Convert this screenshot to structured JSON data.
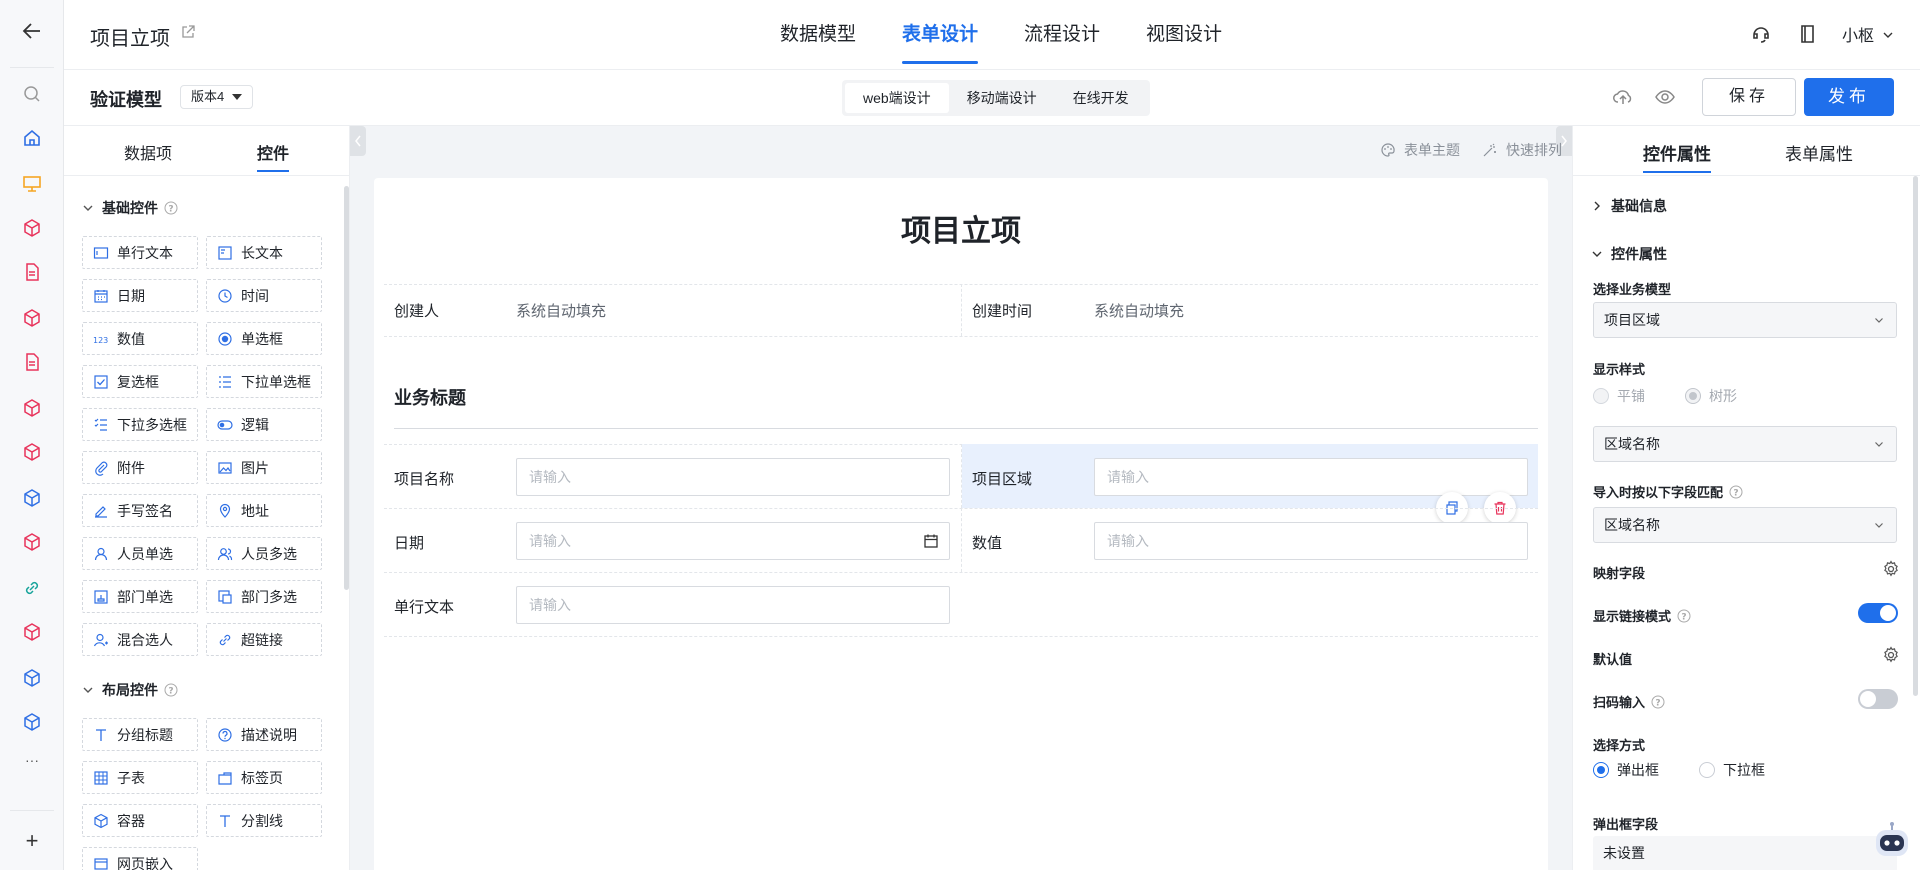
{
  "header": {
    "title": "项目立项",
    "tabs": [
      {
        "label": "数据模型"
      },
      {
        "label": "表单设计"
      },
      {
        "label": "流程设计"
      },
      {
        "label": "视图设计"
      }
    ],
    "user": "小枢"
  },
  "subbar": {
    "model_name": "验证模型",
    "version": "版本4",
    "modes": [
      {
        "label": "web端设计"
      },
      {
        "label": "移动端设计"
      },
      {
        "label": "在线开发"
      }
    ],
    "save_label": "保存",
    "publish_label": "发布"
  },
  "left_panel": {
    "tabs": [
      {
        "label": "数据项"
      },
      {
        "label": "控件"
      }
    ],
    "basic_group": "基础控件",
    "basic_controls": [
      {
        "label": "单行文本"
      },
      {
        "label": "长文本"
      },
      {
        "label": "日期"
      },
      {
        "label": "时间"
      },
      {
        "label": "数值"
      },
      {
        "label": "单选框"
      },
      {
        "label": "复选框"
      },
      {
        "label": "下拉单选框"
      },
      {
        "label": "下拉多选框"
      },
      {
        "label": "逻辑"
      },
      {
        "label": "附件"
      },
      {
        "label": "图片"
      },
      {
        "label": "手写签名"
      },
      {
        "label": "地址"
      },
      {
        "label": "人员单选"
      },
      {
        "label": "人员多选"
      },
      {
        "label": "部门单选"
      },
      {
        "label": "部门多选"
      },
      {
        "label": "混合选人"
      },
      {
        "label": "超链接"
      }
    ],
    "layout_group": "布局控件",
    "layout_controls": [
      {
        "label": "分组标题"
      },
      {
        "label": "描述说明"
      },
      {
        "label": "子表"
      },
      {
        "label": "标签页"
      },
      {
        "label": "容器"
      },
      {
        "label": "分割线"
      },
      {
        "label": "网页嵌入"
      }
    ]
  },
  "canvas": {
    "tools": [
      {
        "label": "表单主题"
      },
      {
        "label": "快速排列"
      }
    ],
    "form_title": "项目立项",
    "creator_label": "创建人",
    "creator_value": "系统自动填充",
    "created_time_label": "创建时间",
    "created_time_value": "系统自动填充",
    "section_title": "业务标题",
    "fields": {
      "project_name": {
        "label": "项目名称",
        "placeholder": "请输入"
      },
      "project_area": {
        "label": "项目区域",
        "placeholder": "请输入"
      },
      "date": {
        "label": "日期",
        "placeholder": "请输入"
      },
      "number": {
        "label": "数值",
        "placeholder": "请输入"
      },
      "single_text": {
        "label": "单行文本",
        "placeholder": "请输入"
      }
    }
  },
  "right_panel": {
    "tabs": [
      {
        "label": "控件属性"
      },
      {
        "label": "表单属性"
      }
    ],
    "basic_info": "基础信息",
    "control_props": "控件属性",
    "biz_model_label": "选择业务模型",
    "biz_model_value": "项目区域",
    "display_style_label": "显示样式",
    "display_style_options": [
      {
        "label": "平铺",
        "checked": false
      },
      {
        "label": "树形",
        "checked": true
      }
    ],
    "display_field_value": "区域名称",
    "import_match_label": "导入时按以下字段匹配",
    "import_match_value": "区域名称",
    "mapping_label": "映射字段",
    "show_link_label": "显示链接模式",
    "show_link_on": true,
    "default_label": "默认值",
    "scan_label": "扫码输入",
    "scan_on": false,
    "select_mode_label": "选择方式",
    "select_mode_options": [
      {
        "label": "弹出框",
        "checked": true
      },
      {
        "label": "下拉框",
        "checked": false
      }
    ],
    "popup_fields_label": "弹出框字段",
    "popup_fields_value": "未设置"
  },
  "colors": {
    "primary": "#1f6feb",
    "rail_icon_red": "#e8335b",
    "rail_icon_blue": "#2f6fe4",
    "rail_icon_orange": "#f5a623",
    "rail_icon_teal": "#16a39a"
  }
}
